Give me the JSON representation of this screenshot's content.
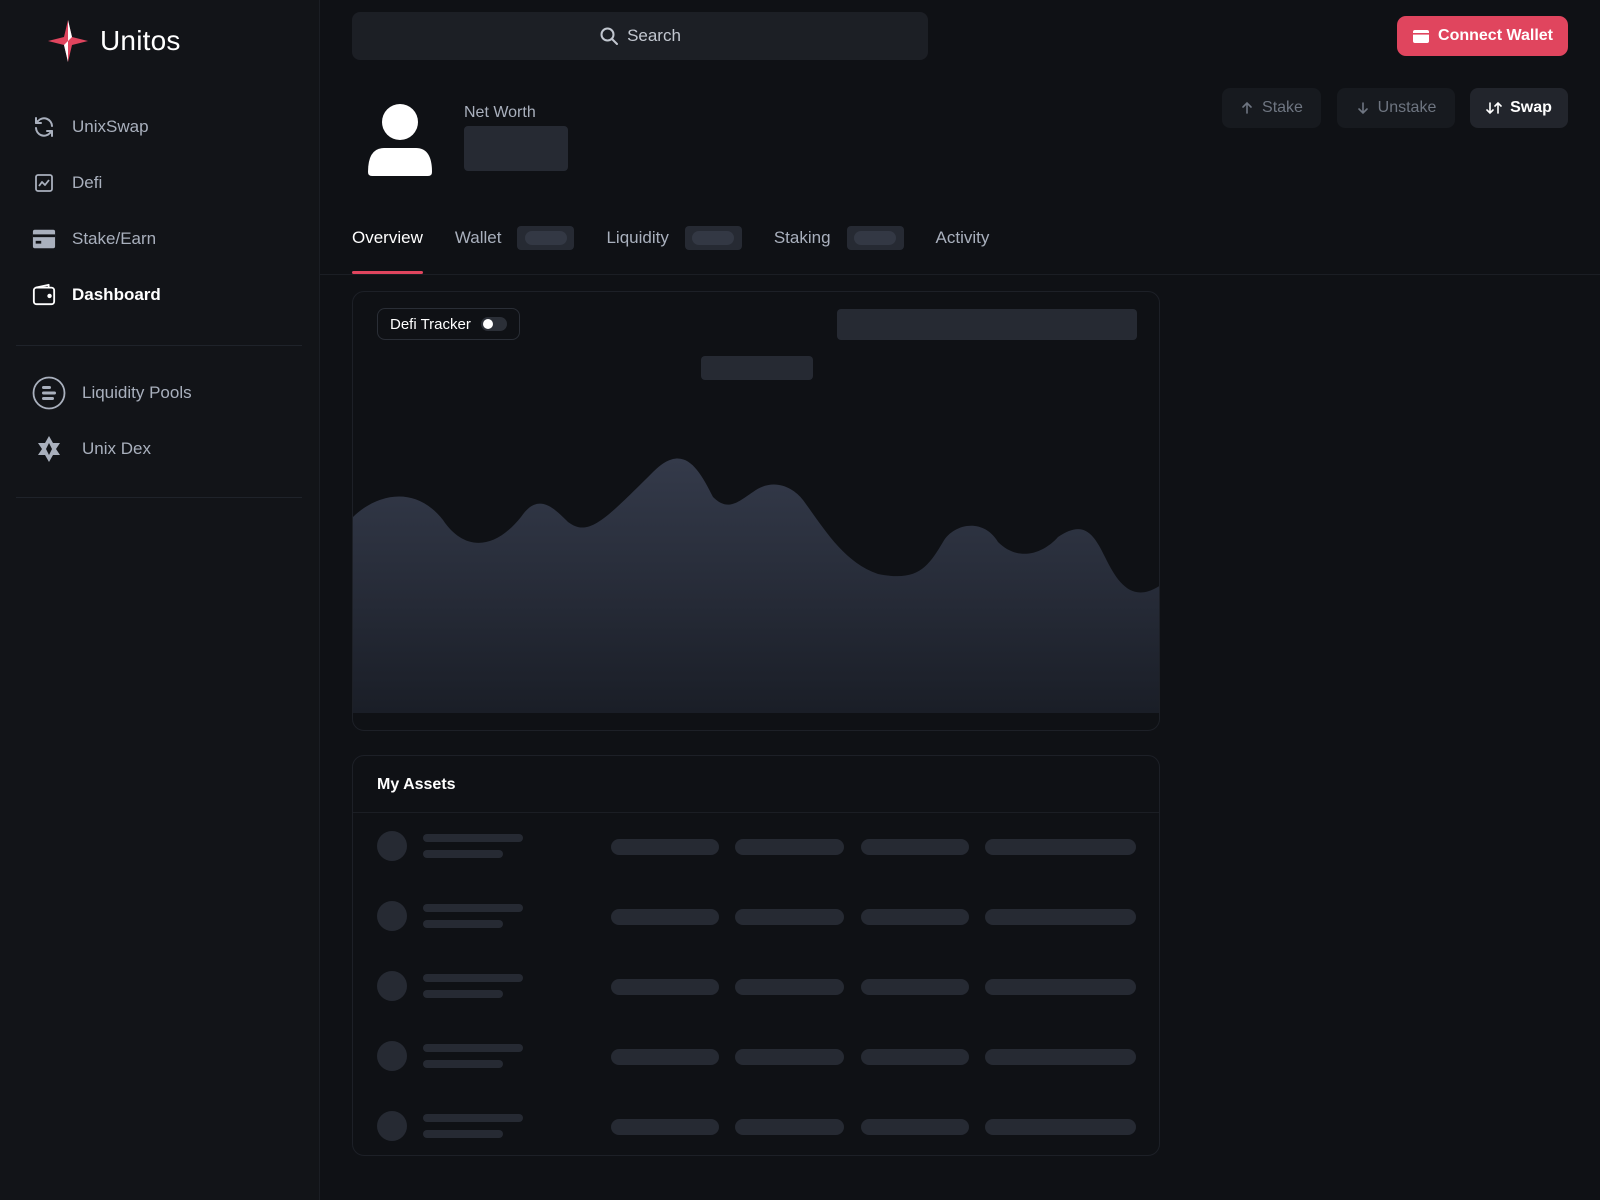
{
  "brand": {
    "name": "Unitos",
    "accent": "#e0455e"
  },
  "sidebar": {
    "items": [
      {
        "label": "UnixSwap",
        "icon": "refresh-icon"
      },
      {
        "label": "Defi",
        "icon": "chart-icon"
      },
      {
        "label": "Stake/Earn",
        "icon": "card-icon"
      },
      {
        "label": "Dashboard",
        "icon": "wallet-icon",
        "active": true
      }
    ],
    "secondary": [
      {
        "label": "Liquidity Pools",
        "icon": "pools-icon"
      },
      {
        "label": "Unix Dex",
        "icon": "dex-icon"
      }
    ]
  },
  "header": {
    "search_label": "Search",
    "connect_label": "Connect Wallet"
  },
  "profile": {
    "net_worth_label": "Net Worth"
  },
  "actions": {
    "stake": "Stake",
    "unstake": "Unstake",
    "swap": "Swap"
  },
  "tabs": [
    {
      "label": "Overview",
      "active": true
    },
    {
      "label": "Wallet"
    },
    {
      "label": "Liquidity"
    },
    {
      "label": "Staking"
    },
    {
      "label": "Activity"
    }
  ],
  "chart": {
    "toggle_label": "Defi Tracker",
    "toggle_on": false
  },
  "assets": {
    "title": "My Assets"
  }
}
